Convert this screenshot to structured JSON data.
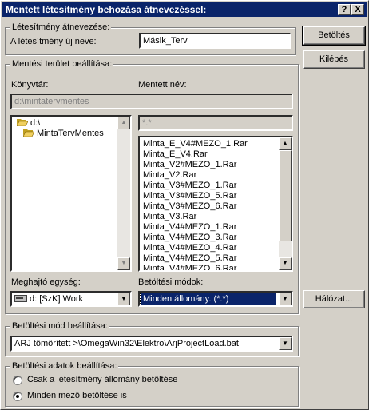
{
  "window": {
    "title": "Mentett létesítmény behozása átnevezéssel:",
    "help_button": "?",
    "close_button": "X"
  },
  "rename_group": {
    "title": "Létesítmény átnevezése:",
    "new_name_label": "A létesítmény új neve:",
    "new_name_value": "Másik_Terv"
  },
  "buttons": {
    "load": "Betöltés",
    "exit": "Kilépés",
    "network": "Hálózat..."
  },
  "save_area": {
    "title": "Mentési terület beállítása:",
    "directory_label": "Könyvtár:",
    "saved_name_label": "Mentett név:",
    "directory_path": "d:\\mintatervmentes",
    "filter": "*.*",
    "folders": [
      {
        "name": "d:\\",
        "icon": "folder-open-icon",
        "indent": 0
      },
      {
        "name": "MintaTervMentes",
        "icon": "folder-open-icon",
        "indent": 1
      }
    ],
    "files": [
      "Minta_E_V4#MEZO_1.Rar",
      "Minta_E_V4.Rar",
      "Minta_V2#MEZO_1.Rar",
      "Minta_V2.Rar",
      "Minta_V3#MEZO_1.Rar",
      "Minta_V3#MEZO_5.Rar",
      "Minta_V3#MEZO_6.Rar",
      "Minta_V3.Rar",
      "Minta_V4#MEZO_1.Rar",
      "Minta_V4#MEZO_3.Rar",
      "Minta_V4#MEZO_4.Rar",
      "Minta_V4#MEZO_5.Rar",
      "Minta_V4#MEZO_6.Rar"
    ],
    "drive_label": "Meghajtó egység:",
    "drive_value": "d: [SzK] Work",
    "load_modes_label": "Betöltési módok:",
    "load_modes_value": "Minden állomány. (*.*)"
  },
  "load_mode_setting": {
    "title": "Betöltési mód beállítása:",
    "value": "ARJ tömörített >\\OmegaWin32\\Elektro\\ArjProjectLoad.bat"
  },
  "load_data_setting": {
    "title": "Betöltési adatok beállítása:",
    "option_1": "Csak a létesítmény állomány betöltése",
    "option_2": "Minden mező betöltése is",
    "selected": "option_2"
  },
  "colors": {
    "titlebar": "#0a246a",
    "face": "#d4d0c8",
    "selection": "#0a246a"
  }
}
